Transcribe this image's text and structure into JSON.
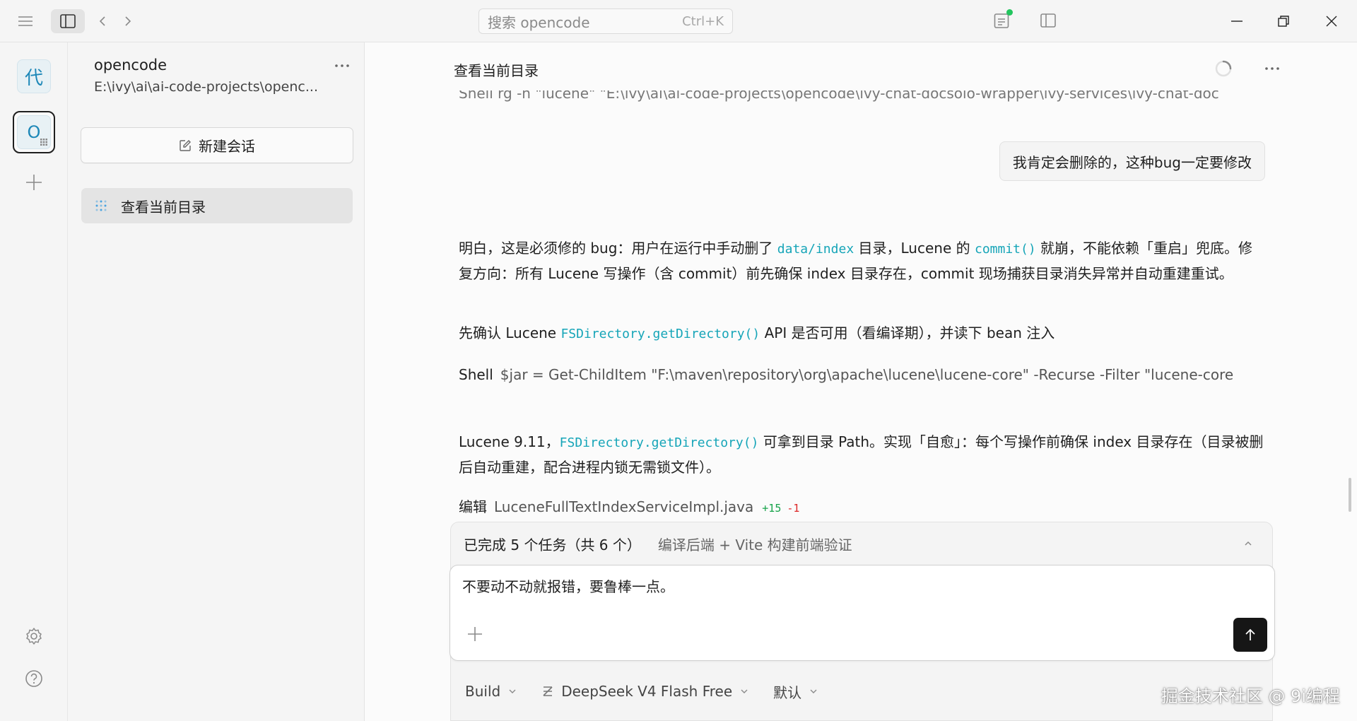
{
  "titlebar": {
    "search_placeholder": "搜索 opencode",
    "search_shortcut": "Ctrl+K"
  },
  "rail": {
    "project_initial": "代",
    "active_project_initial": "O"
  },
  "sessions": {
    "project_name": "opencode",
    "project_path": "E:\\ivy\\ai\\ai-code-projects\\openc...",
    "new_session_label": "新建会话",
    "items": [
      {
        "label": "查看当前目录"
      }
    ]
  },
  "main": {
    "title": "查看当前目录",
    "cut_shell": "Shell  rg -n \"lucene\" \"E:\\ivy\\ai\\ai-code-projects\\opencode\\ivy-chat-docsolo-wrapper\\ivy-services\\ivy-chat-doc",
    "user_message": "我肯定会删除的，这种bug一定要修改",
    "p1": {
      "t1": "明白，这是必须修的 bug：用户在运行中手动删了 ",
      "c1": "data/index",
      "t2": " 目录，Lucene 的 ",
      "c2": "commit()",
      "t3": " 就崩，不能依赖「重启」兜底。修复方向：所有 Lucene 写操作（含 commit）前先确保 index 目录存在，commit 现场捕获目录消失异常并自动重建重试。"
    },
    "p2": {
      "t1": "先确认 Lucene ",
      "c1": "FSDirectory.getDirectory()",
      "t2": " API 是否可用（看编译期），并读下 bean 注入"
    },
    "shell": {
      "label": "Shell",
      "command": "$jar = Get-ChildItem \"F:\\maven\\repository\\org\\apache\\lucene\\lucene-core\" -Recurse -Filter \"lucene-core"
    },
    "p3": {
      "t1": "Lucene 9.11，",
      "c1": "FSDirectory.getDirectory()",
      "t2": " 可拿到目录 Path。实现「自愈」：每个写操作前确保 index 目录存在（目录被删后自动重建，配合进程内锁无需锁文件）。"
    },
    "edit": {
      "label": "编辑",
      "file": "LuceneFullTextIndexServiceImpl.java",
      "added": "+15",
      "removed": "-1"
    }
  },
  "composer": {
    "tasks_done": "已完成 5 个任务（共 6 个）",
    "tasks_current": "编译后端 + Vite 构建前端验证",
    "input_text": "不要动不动就报错，要鲁棒一点。",
    "options": {
      "mode": "Build",
      "model": "DeepSeek V4 Flash Free",
      "variant": "默认"
    }
  },
  "watermark": "掘金技术社区 @ 9i编程",
  "colors": {
    "code": "#16a5b8",
    "added": "#17a34a",
    "removed": "#dc2626",
    "status_dot": "#22c55e"
  }
}
